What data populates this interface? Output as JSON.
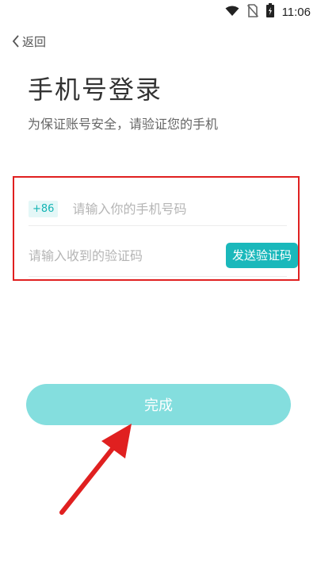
{
  "status_bar": {
    "time": "11:06",
    "icons": [
      "wifi-icon",
      "no-sim-icon",
      "battery-charging-icon"
    ]
  },
  "nav": {
    "back_label": "返回",
    "back_icon": "chevron-left-icon"
  },
  "header": {
    "title": "手机号登录",
    "subtitle": "为保证账号安全，请验证您的手机"
  },
  "form": {
    "country_code": "+86",
    "phone_placeholder": "请输入你的手机号码",
    "code_placeholder": "请输入收到的验证码",
    "send_code_label": "发送验证码"
  },
  "actions": {
    "done_label": "完成"
  },
  "colors": {
    "accent": "#1ab8bb",
    "done_button": "#84dede",
    "highlight_box": "#e02020",
    "annotation_arrow": "#e02020"
  }
}
